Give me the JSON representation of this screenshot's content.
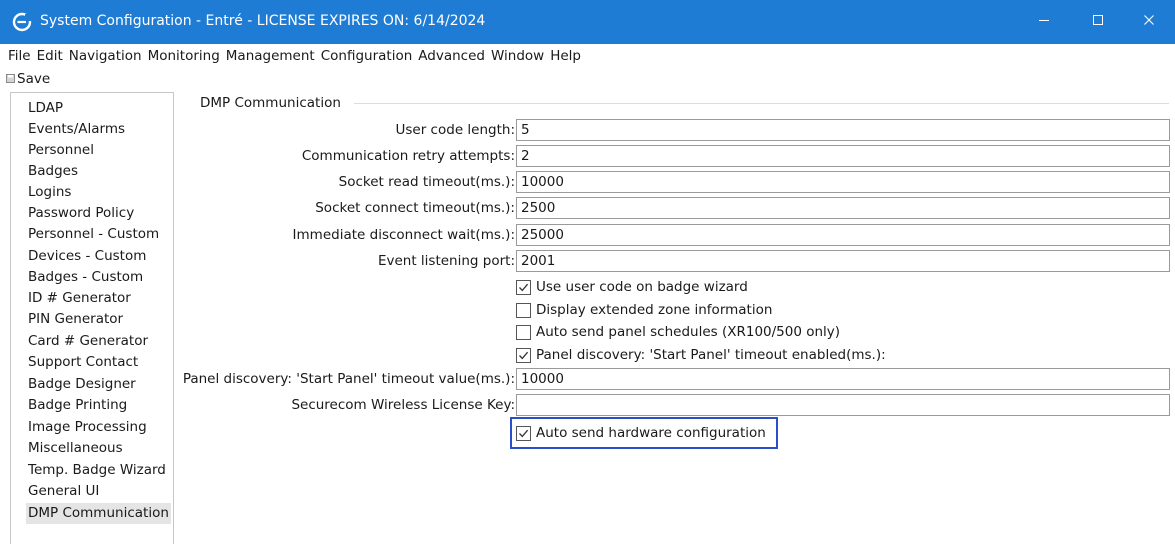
{
  "window": {
    "title": "System Configuration - Entré - LICENSE EXPIRES ON: 6/14/2024",
    "titlebar_color": "#1f7cd4",
    "app_icon": "entre-logo-icon"
  },
  "menu": [
    "File",
    "Edit",
    "Navigation",
    "Monitoring",
    "Management",
    "Configuration",
    "Advanced",
    "Window",
    "Help"
  ],
  "toolbar": {
    "save_label": "Save",
    "save_icon": "save-icon"
  },
  "nav": {
    "items": [
      "LDAP",
      "Events/Alarms",
      "Personnel",
      "Badges",
      "Logins",
      "Password Policy",
      "Personnel - Custom",
      "Devices - Custom",
      "Badges - Custom",
      "ID # Generator",
      "PIN Generator",
      "Card # Generator",
      "Support Contact",
      "Badge Designer",
      "Badge Printing",
      "Image Processing",
      "Miscellaneous",
      "Temp. Badge Wizard",
      "General UI",
      "DMP Communication"
    ],
    "selected": "DMP Communication"
  },
  "panel": {
    "section_title": "DMP Communication",
    "fields": [
      {
        "label": "User code length:",
        "value": "5"
      },
      {
        "label": "Communication retry attempts:",
        "value": "2"
      },
      {
        "label": "Socket read timeout(ms.):",
        "value": "10000"
      },
      {
        "label": "Socket connect timeout(ms.):",
        "value": "2500"
      },
      {
        "label": "Immediate disconnect wait(ms.):",
        "value": "25000"
      },
      {
        "label": "Event listening port:",
        "value": "2001"
      }
    ],
    "checkboxes": [
      {
        "label": "Use user code on badge wizard",
        "checked": true
      },
      {
        "label": "Display extended zone information",
        "checked": false
      },
      {
        "label": "Auto send panel schedules (XR100/500 only)",
        "checked": false
      },
      {
        "label": "Panel discovery: 'Start Panel' timeout enabled(ms.):",
        "checked": true
      }
    ],
    "fields2": [
      {
        "label": "Panel discovery: 'Start Panel' timeout value(ms.):",
        "value": "10000"
      },
      {
        "label": "Securecom Wireless License Key:",
        "value": ""
      }
    ],
    "final_checkbox": {
      "label": "Auto send hardware configuration",
      "checked": true
    },
    "highlight_color": "#2a4fc9"
  }
}
